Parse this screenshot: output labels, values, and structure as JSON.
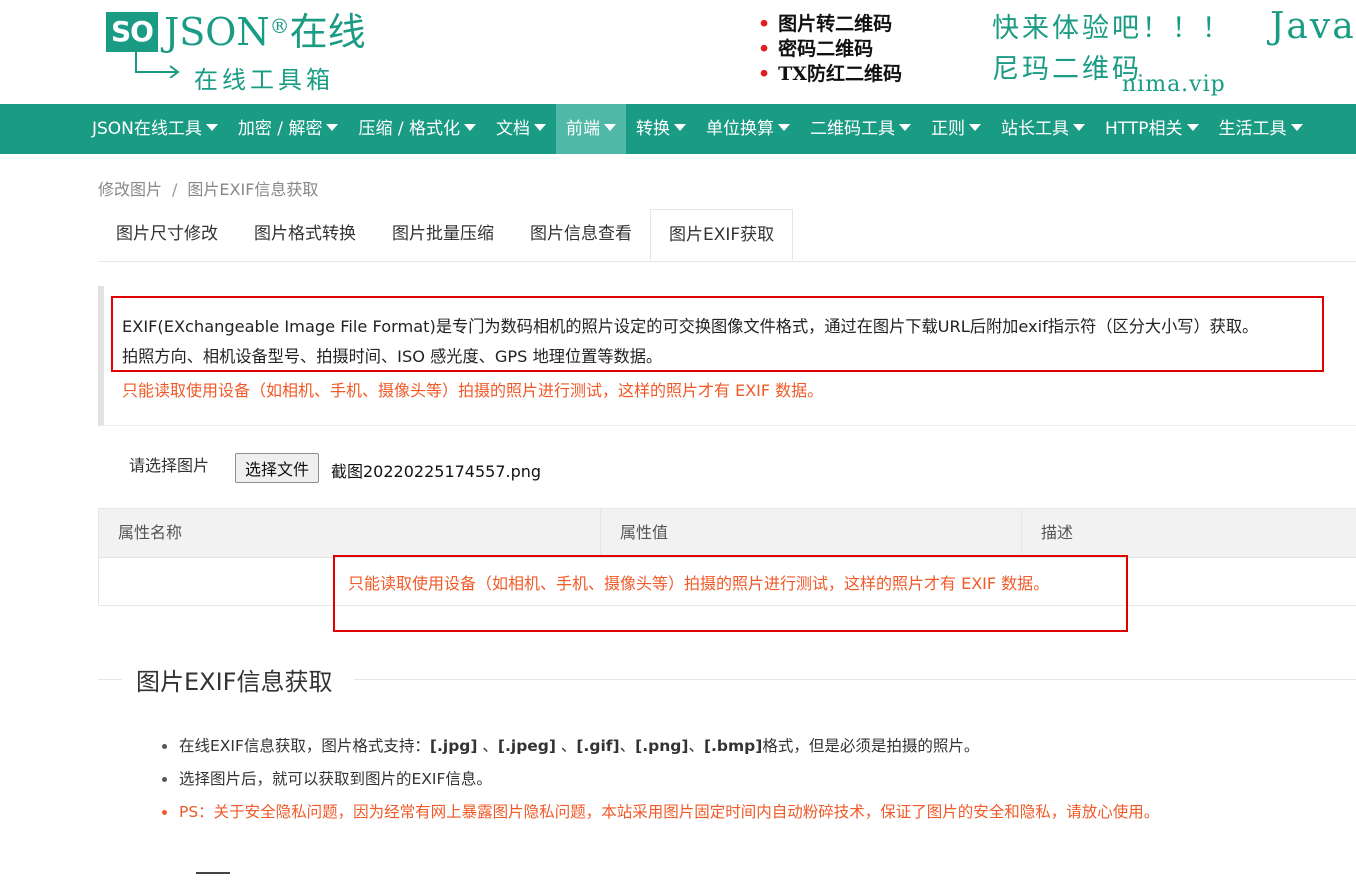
{
  "header": {
    "logo": {
      "so": "SO",
      "json": "JSON",
      "reg": "®",
      "zaixian": "在线",
      "subtitle": "在线工具箱"
    },
    "ad_left": [
      "图片转二维码",
      "密码二维码",
      "TX防红二维码"
    ],
    "ad_right": {
      "line1": "快来体验吧！！！",
      "line2": "尼玛二维码",
      "line3": "nima.vip",
      "java": "JavaS"
    }
  },
  "nav": {
    "items": [
      {
        "label": "JSON在线工具"
      },
      {
        "label": "加密 / 解密"
      },
      {
        "label": "压缩 / 格式化"
      },
      {
        "label": "文档"
      },
      {
        "label": "前端",
        "active": true
      },
      {
        "label": "转换"
      },
      {
        "label": "单位换算"
      },
      {
        "label": "二维码工具"
      },
      {
        "label": "正则"
      },
      {
        "label": "站长工具"
      },
      {
        "label": "HTTP相关"
      },
      {
        "label": "生活工具"
      }
    ]
  },
  "breadcrumb": {
    "parent": "修改图片",
    "separator": "/",
    "current": "图片EXIF信息获取"
  },
  "tabs": [
    {
      "label": "图片尺寸修改"
    },
    {
      "label": "图片格式转换"
    },
    {
      "label": "图片批量压缩"
    },
    {
      "label": "图片信息查看"
    },
    {
      "label": "图片EXIF获取",
      "active": true
    }
  ],
  "intro": {
    "line1": "EXIF(EXchangeable Image File Format)是专门为数码相机的照片设定的可交换图像文件格式，通过在图片下载URL后附加exif指示符（区分大小写）获取。",
    "line2": "拍照方向、相机设备型号、拍摄时间、ISO 感光度、GPS 地理位置等数据。",
    "warning": "只能读取使用设备（如相机、手机、摄像头等）拍摄的照片进行测试，这样的照片才有 EXIF 数据。"
  },
  "file_picker": {
    "label": "请选择图片",
    "button": "选择文件",
    "file_name": "截图20220225174557.png"
  },
  "table": {
    "headers": [
      "属性名称",
      "属性值",
      "描述"
    ],
    "empty_message": "只能读取使用设备（如相机、手机、摄像头等）拍摄的照片进行测试，这样的照片才有 EXIF 数据。"
  },
  "section": {
    "title": "图片EXIF信息获取",
    "notes": {
      "n1_pre": "在线EXIF信息获取，图片格式支持：",
      "n1_f1": "[.jpg]",
      "n1_s1": " 、",
      "n1_f2": "[.jpeg]",
      "n1_s2": " 、",
      "n1_f3": "[.gif]",
      "n1_s3": "、",
      "n1_f4": "[.png]",
      "n1_s4": "、",
      "n1_f5": "[.bmp]",
      "n1_post": "格式，但是必须是拍摄的照片。",
      "n2": "选择图片后，就可以获取到图片的EXIF信息。",
      "n3": "PS：关于安全隐私问题，因为经常有网上暴露图片隐私问题，本站采用图片固定时间内自动粉碎技术，保证了图片的安全和隐私，请放心使用。"
    }
  },
  "colors": {
    "brand": "#1a9b84",
    "nav_active": "#4fb8a7",
    "warning": "#f05a28",
    "highlight_box": "#e00000"
  }
}
